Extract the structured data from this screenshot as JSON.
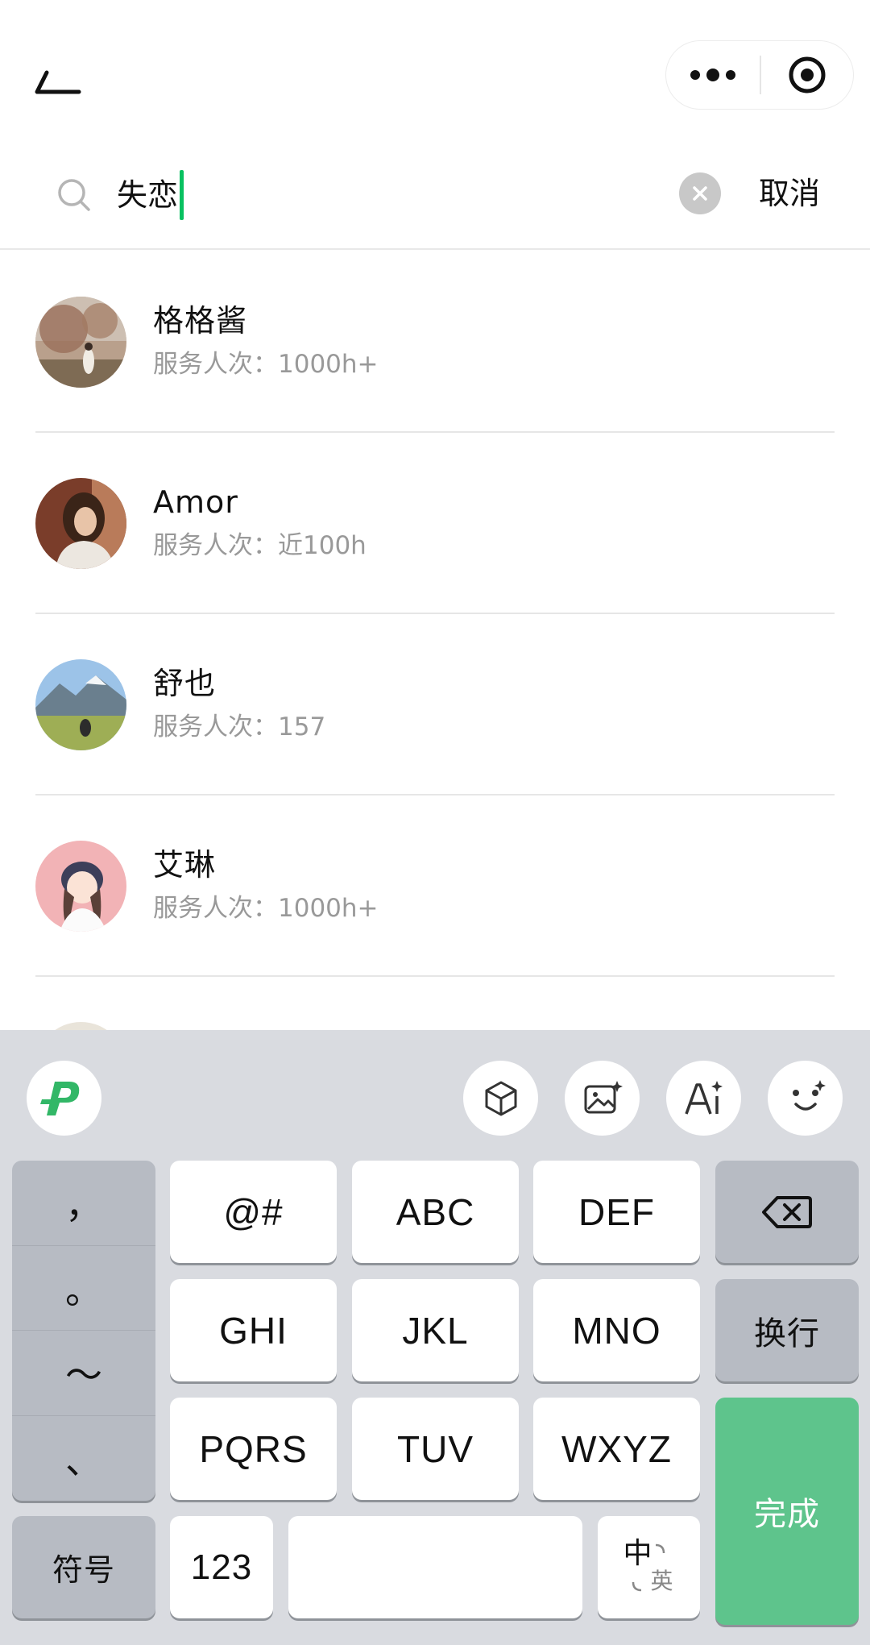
{
  "search": {
    "query": "失恋",
    "cancel_label": "取消"
  },
  "results": [
    {
      "name": "格格酱",
      "stat": "服务人次：1000h+",
      "avatar": "woman-in-autumn-field-photo"
    },
    {
      "name": "Amor",
      "stat": "服务人次：近100h",
      "avatar": "woman-portrait-photo"
    },
    {
      "name": "舒也",
      "stat": "服务人次：157",
      "avatar": "mountain-meadow-photo"
    },
    {
      "name": "艾琳",
      "stat": "服务人次：1000h+",
      "avatar": "cartoon-girl-illustration"
    }
  ],
  "keyboard": {
    "toolbar_icons": [
      "pinyin-logo-icon",
      "cube-icon",
      "image-sparkle-icon",
      "ai-icon",
      "face-emoji-icon"
    ],
    "punctuation": [
      "，",
      "。",
      "～",
      "、"
    ],
    "rows": [
      [
        "@#",
        "ABC",
        "DEF"
      ],
      [
        "GHI",
        "JKL",
        "MNO"
      ],
      [
        "PQRS",
        "TUV",
        "WXYZ"
      ]
    ],
    "newline_label": "换行",
    "done_label": "完成",
    "symbols_label": "符号",
    "numbers_label": "123",
    "lang_main": "中",
    "lang_alt": "英",
    "accent_color": "#5ec48c"
  },
  "colors": {
    "caret": "#07c160",
    "secondary_text": "#999999",
    "keyboard_bg": "#d9dbe0"
  }
}
